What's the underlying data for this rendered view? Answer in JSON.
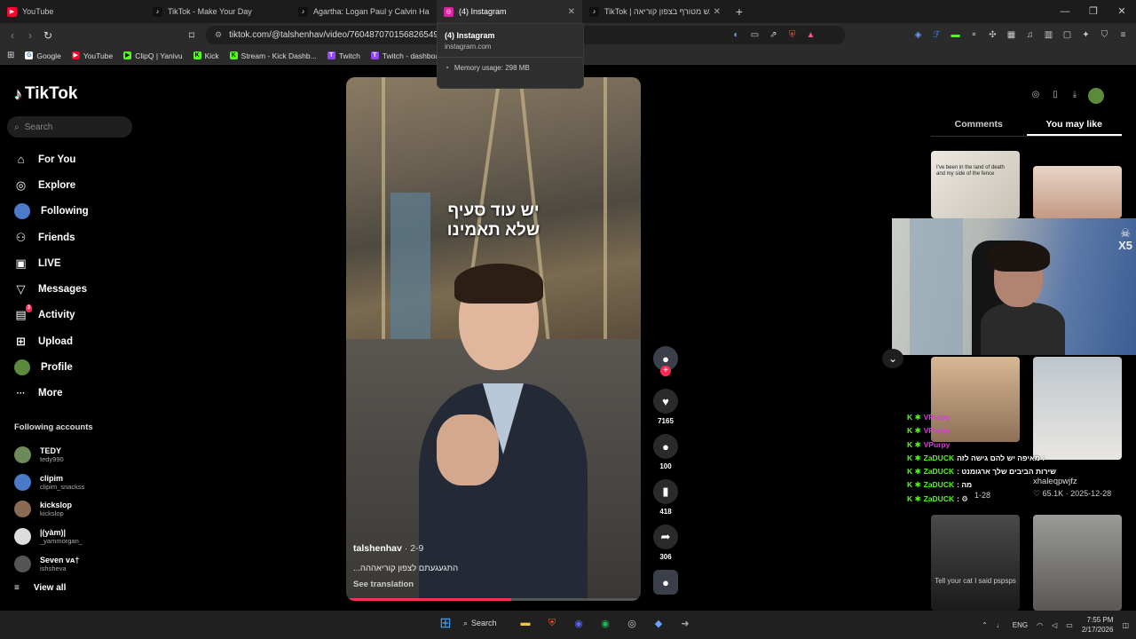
{
  "browser": {
    "tabs": [
      {
        "title": "YouTube",
        "fav_color": "#ff0033",
        "fav_glyph": "▶"
      },
      {
        "title": "TikTok - Make Your Day",
        "fav_color": "#111111",
        "fav_glyph": "♪"
      },
      {
        "title": "Agartha: Logan Paul y Calvin Harris ci",
        "fav_color": "#111111",
        "fav_glyph": "♪"
      },
      {
        "title": "(4) Instagram",
        "fav_color": "#d6249f",
        "fav_glyph": "◎"
      },
      {
        "title": "TikTok | עונש מטורף בצפון קוריאה",
        "fav_color": "#111111",
        "fav_glyph": "♪"
      }
    ],
    "url": "tiktok.com/@talshenhav/video/7604870701568265493?is",
    "bookmarks": [
      {
        "label": "Google",
        "color": "#4285f4",
        "glyph": "G"
      },
      {
        "label": "YouTube",
        "color": "#ff0033",
        "glyph": "▶"
      },
      {
        "label": "ClipQ | Yanivu",
        "color": "#53fc18",
        "glyph": "▶"
      },
      {
        "label": "Kick",
        "color": "#53fc18",
        "glyph": "K"
      },
      {
        "label": "Stream - Kick Dashb...",
        "color": "#53fc18",
        "glyph": "K"
      },
      {
        "label": "Twitch",
        "color": "#9146ff",
        "glyph": "T"
      },
      {
        "label": "Twitch - dashboard",
        "color": "#9146ff",
        "glyph": "T"
      }
    ],
    "hovercard": {
      "title": "(4) Instagram",
      "domain": "instagram.com",
      "memory": "Memory usage: 298 MB"
    }
  },
  "sidebar": {
    "logo": "TikTok",
    "search_placeholder": "Search",
    "menu": [
      {
        "label": "For You",
        "icon": "home-icon",
        "glyph": "⌂"
      },
      {
        "label": "Explore",
        "icon": "compass-icon",
        "glyph": "◎"
      },
      {
        "label": "Following",
        "icon": "following-avatar-icon",
        "glyph": "●"
      },
      {
        "label": "Friends",
        "icon": "friends-icon",
        "glyph": "⚇"
      },
      {
        "label": "LIVE",
        "icon": "live-icon",
        "glyph": "▣"
      },
      {
        "label": "Messages",
        "icon": "messages-icon",
        "glyph": "▽"
      },
      {
        "label": "Activity",
        "icon": "activity-icon",
        "glyph": "▤",
        "badge": "3"
      },
      {
        "label": "Upload",
        "icon": "upload-icon",
        "glyph": "⊞"
      },
      {
        "label": "Profile",
        "icon": "profile-avatar-icon",
        "glyph": "●"
      },
      {
        "label": "More",
        "icon": "more-icon",
        "glyph": "···"
      }
    ],
    "following_title": "Following accounts",
    "accounts": [
      {
        "name": "TEDY",
        "handle": "tedy990",
        "color": "#6f8a5a"
      },
      {
        "name": "clipim",
        "handle": "clipim_snackss",
        "color": "#4a7ac8"
      },
      {
        "name": "kickslop",
        "handle": "kickslop",
        "color": "#8a6a50"
      },
      {
        "name": "|(yàm)|",
        "handle": "_yammorgan_",
        "color": "#dddddd"
      },
      {
        "name": "Seven vᴀ†",
        "handle": "ishsheva",
        "color": "#555555"
      }
    ],
    "view_all": "View all"
  },
  "video": {
    "caption_line1": "יש עוד סעיף",
    "caption_line2": "שלא תאמינו",
    "author": "talshenhav",
    "date": "· 2-9",
    "description": "...התגעגעתם לצפון קוריאההה",
    "see_translation": "See translation",
    "progress": 0.56,
    "likes": "7165",
    "comments": "100",
    "saves": "418",
    "shares": "306"
  },
  "right_panel": {
    "tabs": [
      "Comments",
      "You may like"
    ],
    "thumb1_text": "I've been in the land of death and my side of the fence",
    "thumb5_text": "Tell your cat I said pspsps",
    "caption": "xhaleqpwjfz",
    "likes_date": "♡ 65.1K · 2025-12-28",
    "date2": "1-28"
  },
  "webcam": {
    "multiplier": "X5"
  },
  "chat": [
    {
      "user": "VPurpy",
      "msg": "",
      "ucolor": "#d83bd8"
    },
    {
      "user": "VPurpy",
      "msg": "",
      "ucolor": "#d83bd8"
    },
    {
      "user": "VPurpy",
      "msg": "",
      "ucolor": "#d83bd8"
    },
    {
      "user": "ZaDUCK",
      "msg": "מאיפה יש להם גישה לזה :",
      "ucolor": "#53fc18"
    },
    {
      "user": "ZaDUCK",
      "msg": ": שירות הביבים שלך ארגומנט",
      "ucolor": "#53fc18"
    },
    {
      "user": "ZaDUCK",
      "msg": ": מה",
      "ucolor": "#53fc18"
    },
    {
      "user": "ZaDUCK",
      "msg": ": ⚙",
      "ucolor": "#53fc18"
    }
  ],
  "taskbar": {
    "search": "Search",
    "lang": "ENG",
    "time": "7:55 PM",
    "date": "2/17/2026"
  }
}
